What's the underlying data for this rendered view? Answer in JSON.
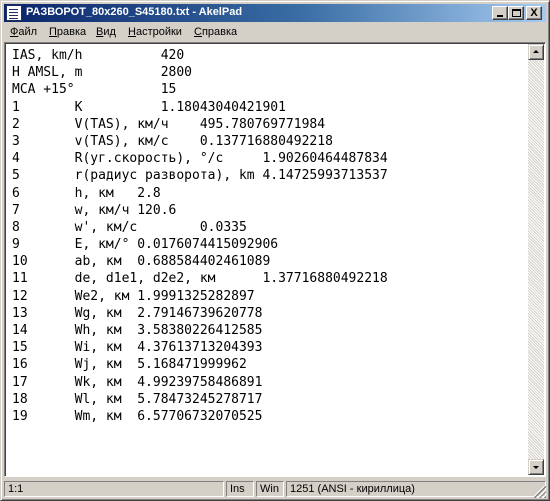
{
  "window": {
    "title": "РАЗВОРОТ_80x260_S45180.txt - AkelPad",
    "minimize_label": "_",
    "close_label": "X"
  },
  "menu": [
    {
      "label": "Файл",
      "mnemonic": "Ф"
    },
    {
      "label": "Правка",
      "mnemonic": "П"
    },
    {
      "label": "Вид",
      "mnemonic": "В"
    },
    {
      "label": "Настройки",
      "mnemonic": "Н"
    },
    {
      "label": "Справка",
      "mnemonic": "С"
    }
  ],
  "editor": {
    "lines": [
      "IAS, km/h          420",
      "H AMSL, m          2800",
      "MCA +15°           15",
      "1       K          1.18043040421901",
      "2       V(TAS), км/ч    495.780769771984",
      "3       v(TAS), км/с    0.137716880492218",
      "4       R(уг.скорость), °/с     1.90260464487834",
      "5       r(радиус разворота), km 4.14725993713537",
      "6       h, км   2.8",
      "7       w, км/ч 120.6",
      "8       w', км/с        0.0335",
      "9       E, км/° 0.0176074415092906",
      "10      ab, км  0.688584402461089",
      "11      de, d1e1, d2e2, км      1.37716880492218",
      "12      We2, км 1.9991325282897",
      "13      Wg, км  2.79146739620778",
      "14      Wh, км  3.58380226412585",
      "15      Wi, км  4.37613713204393",
      "16      Wj, км  5.168471999962",
      "17      Wk, км  4.99239758486891",
      "18      Wl, км  5.78473245278717",
      "19      Wm, км  6.57706732070525"
    ]
  },
  "statusbar": {
    "position": "1:1",
    "insert_mode": "Ins",
    "newline": "Win",
    "encoding": "1251  (ANSI - кириллица)"
  },
  "colors": {
    "titlebar_start": "#0a246a",
    "titlebar_end": "#a6caf0",
    "face": "#d4d0c8"
  }
}
